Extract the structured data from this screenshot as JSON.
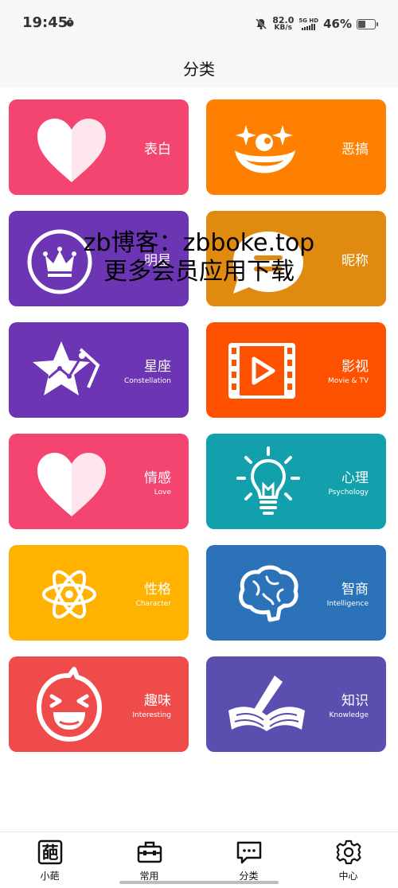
{
  "status_bar": {
    "time": "19:45",
    "net_speed_value": "82.0",
    "net_speed_unit": "KB/s",
    "network_type": "5G HD",
    "battery_percent": "46%",
    "battery_level": 0.46
  },
  "header": {
    "title": "分类"
  },
  "categories": [
    {
      "name": "表白",
      "subtitle": "",
      "color": "#f3456f",
      "icon": "heart-icon"
    },
    {
      "name": "恶搞",
      "subtitle": "",
      "color": "#ff7f00",
      "icon": "clown-face-icon"
    },
    {
      "name": "明星",
      "subtitle": "",
      "color": "#6c35b3",
      "icon": "crown-icon"
    },
    {
      "name": "昵称",
      "subtitle": "",
      "color": "#e08a10",
      "icon": "chat-bubble-icon"
    },
    {
      "name": "星座",
      "subtitle": "Constellation",
      "color": "#6c35b3",
      "icon": "star-constellation-icon"
    },
    {
      "name": "影视",
      "subtitle": "Movie & TV",
      "color": "#ff5200",
      "icon": "film-play-icon"
    },
    {
      "name": "情感",
      "subtitle": "Love",
      "color": "#f3456f",
      "icon": "heart-icon"
    },
    {
      "name": "心理",
      "subtitle": "Psychology",
      "color": "#13a0ad",
      "icon": "lightbulb-icon"
    },
    {
      "name": "性格",
      "subtitle": "Character",
      "color": "#ffb300",
      "icon": "atom-icon"
    },
    {
      "name": "智商",
      "subtitle": "Intelligence",
      "color": "#2b72b8",
      "icon": "brain-icon"
    },
    {
      "name": "趣味",
      "subtitle": "Interesting",
      "color": "#ef4b4b",
      "icon": "laughing-face-icon"
    },
    {
      "name": "知识",
      "subtitle": "Knowledge",
      "color": "#5a4fae",
      "icon": "book-pen-icon"
    }
  ],
  "watermark": {
    "line1": "zb博客：zbboke.top",
    "line2": "更多会员应用下载"
  },
  "tabbar": {
    "items": [
      {
        "label": "小葩",
        "icon": "pa-character-icon",
        "glyph": "葩"
      },
      {
        "label": "常用",
        "icon": "toolbox-icon"
      },
      {
        "label": "分类",
        "icon": "message-icon",
        "selected": true
      },
      {
        "label": "中心",
        "icon": "gear-icon"
      }
    ]
  }
}
